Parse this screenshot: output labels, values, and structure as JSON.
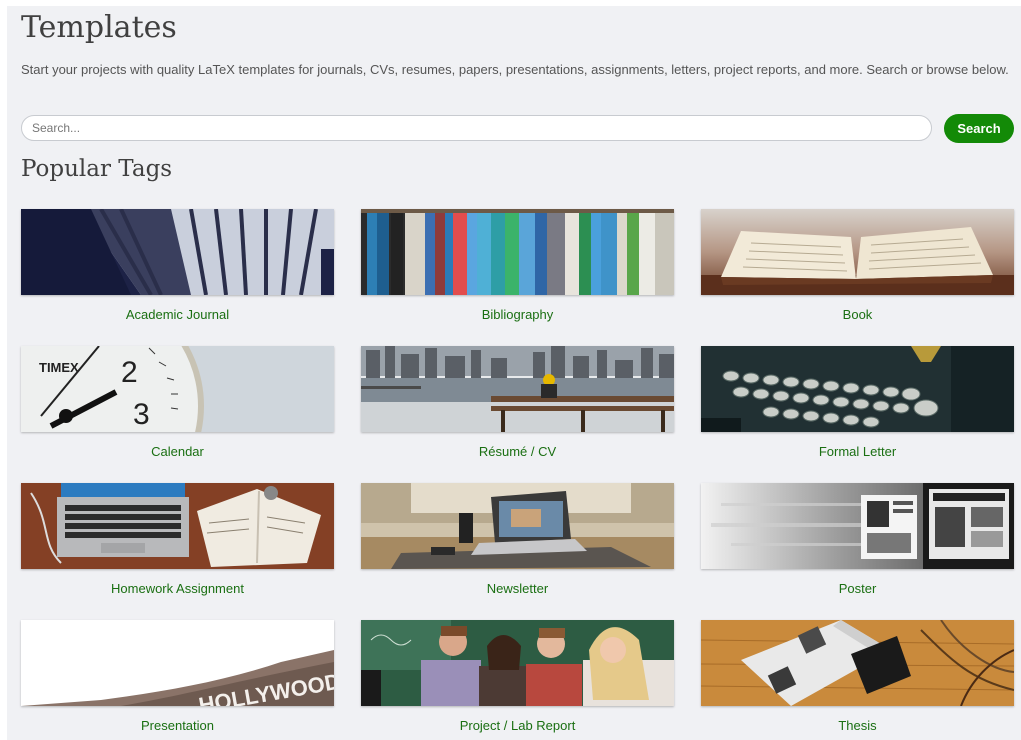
{
  "page": {
    "title": "Templates",
    "intro": "Start your projects with quality LaTeX templates for journals, CVs, resumes, papers, presentations, assignments, letters, project reports, and more. Search or browse below."
  },
  "search": {
    "placeholder": "Search...",
    "button_label": "Search"
  },
  "popular_tags": {
    "heading": "Popular Tags",
    "items": [
      {
        "label": "Academic Journal",
        "image": "library-shelves-photo"
      },
      {
        "label": "Bibliography",
        "image": "book-spines-photo"
      },
      {
        "label": "Book",
        "image": "open-book-photo"
      },
      {
        "label": "Calendar",
        "image": "clock-photo"
      },
      {
        "label": "Résumé / CV",
        "image": "city-bench-photo"
      },
      {
        "label": "Formal Letter",
        "image": "typewriter-photo"
      },
      {
        "label": "Homework Assignment",
        "image": "laptop-notebook-photo"
      },
      {
        "label": "Newsletter",
        "image": "desk-laptop-photo"
      },
      {
        "label": "Poster",
        "image": "poster-photo"
      },
      {
        "label": "Presentation",
        "image": "hollywood-sign-photo"
      },
      {
        "label": "Project / Lab Report",
        "image": "students-photo"
      },
      {
        "label": "Thesis",
        "image": "thesis-book-photo"
      }
    ]
  },
  "colors": {
    "accent": "#138a07",
    "link": "#1a6f12",
    "background": "#f0f1f4"
  }
}
